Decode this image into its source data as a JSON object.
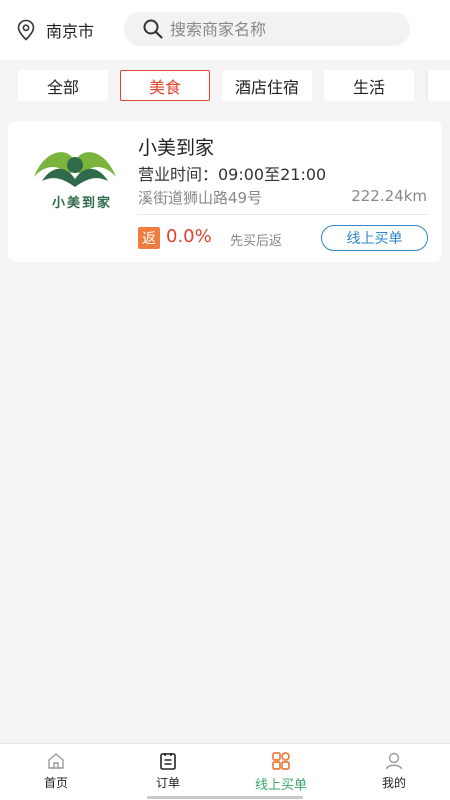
{
  "header": {
    "city": "南京市",
    "search_placeholder": "搜索商家名称"
  },
  "tabs": [
    {
      "label": "全部",
      "active": false
    },
    {
      "label": "美食",
      "active": true
    },
    {
      "label": "酒店住宿",
      "active": false
    },
    {
      "label": "生活",
      "active": false
    }
  ],
  "store": {
    "logo_text": "小美到家",
    "name": "小美到家",
    "hours": "营业时间：09:00至21:00",
    "address": "溪街道狮山路49号",
    "distance": "222.24km",
    "rebate_badge": "返",
    "rebate_rate": "0.0%",
    "rebate_note": "先买后返",
    "buy_button": "线上买单"
  },
  "nav": [
    {
      "label": "首页",
      "icon": "home-icon",
      "active": false
    },
    {
      "label": "订单",
      "icon": "order-icon",
      "active": false
    },
    {
      "label": "线上买单",
      "icon": "grid-icon",
      "active": true
    },
    {
      "label": "我的",
      "icon": "profile-icon",
      "active": false
    }
  ],
  "colors": {
    "accent_red": "#e0442e",
    "button_blue": "#2f86c8",
    "nav_active_green": "#3ba66a",
    "badge_orange": "#ef7b3e"
  }
}
